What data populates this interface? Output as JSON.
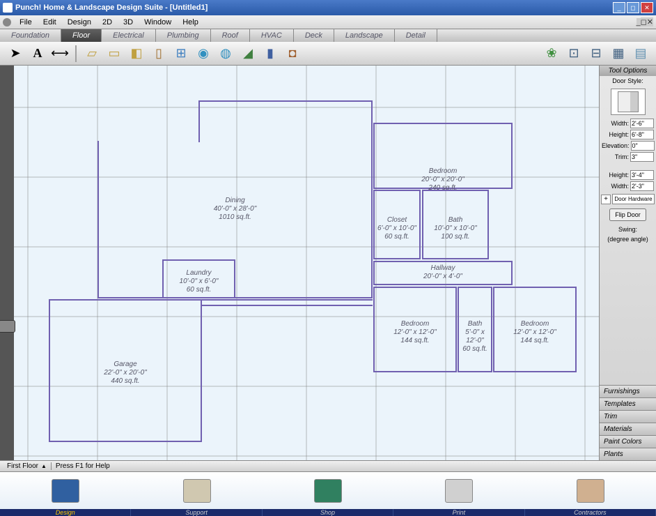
{
  "window": {
    "title": "Punch! Home & Landscape Design Suite - [Untitled1]"
  },
  "menu": [
    "File",
    "Edit",
    "Design",
    "2D",
    "3D",
    "Window",
    "Help"
  ],
  "tabs": [
    {
      "label": "Foundation"
    },
    {
      "label": "Floor",
      "active": true
    },
    {
      "label": "Electrical"
    },
    {
      "label": "Plumbing"
    },
    {
      "label": "Roof"
    },
    {
      "label": "HVAC"
    },
    {
      "label": "Deck"
    },
    {
      "label": "Landscape"
    },
    {
      "label": "Detail"
    }
  ],
  "tooloptions": {
    "title": "Tool Options",
    "subtitle": "Door Style:",
    "fields": [
      {
        "label": "Width:",
        "value": "2'-6\""
      },
      {
        "label": "Height:",
        "value": "6'-8\""
      },
      {
        "label": "Elevation:",
        "value": "0\""
      },
      {
        "label": "Trim:",
        "value": "3\""
      }
    ],
    "fields2": [
      {
        "label": "Height:",
        "value": "3'-4\""
      },
      {
        "label": "Width:",
        "value": "2'-3\""
      }
    ],
    "hardware": "Door Hardware",
    "flip": "Flip Door",
    "swing": "Swing:",
    "swing2": "(degree angle)"
  },
  "side_tabs": [
    "Furnishings",
    "Templates",
    "Trim",
    "Materials",
    "Paint Colors",
    "Plants"
  ],
  "status": {
    "floor": "First Floor",
    "help": "Press F1 for Help"
  },
  "bottom": [
    "Design",
    "Support",
    "Shop",
    "Print",
    "Contractors"
  ],
  "rooms": {
    "dining": {
      "name": "Dining",
      "dim": "40'-0\" x 28'-0\"",
      "area": "1010 sq.ft."
    },
    "laundry": {
      "name": "Laundry",
      "dim": "10'-0\" x 6'-0\"",
      "area": "60 sq.ft."
    },
    "garage": {
      "name": "Garage",
      "dim": "22'-0\" x 20'-0\"",
      "area": "440 sq.ft."
    },
    "bedroom1": {
      "name": "Bedroom",
      "dim": "20'-0\" x 20'-0\"",
      "area": "240 sq.ft."
    },
    "closet": {
      "name": "Closet",
      "dim": "6'-0\" x 10'-0\"",
      "area": "60 sq.ft."
    },
    "bath1": {
      "name": "Bath",
      "dim": "10'-0\" x 10'-0\"",
      "area": "100 sq.ft."
    },
    "hallway": {
      "name": "Hallway",
      "dim": "20'-0\" x 4'-0\"",
      "area": ""
    },
    "bedroom2": {
      "name": "Bedroom",
      "dim": "12'-0\" x 12'-0\"",
      "area": "144 sq.ft."
    },
    "bath2": {
      "name": "Bath",
      "dim": "5'-0\" x 12'-0\"",
      "area": "60 sq.ft."
    },
    "bedroom3": {
      "name": "Bedroom",
      "dim": "12'-0\" x 12'-0\"",
      "area": "144 sq.ft."
    }
  }
}
